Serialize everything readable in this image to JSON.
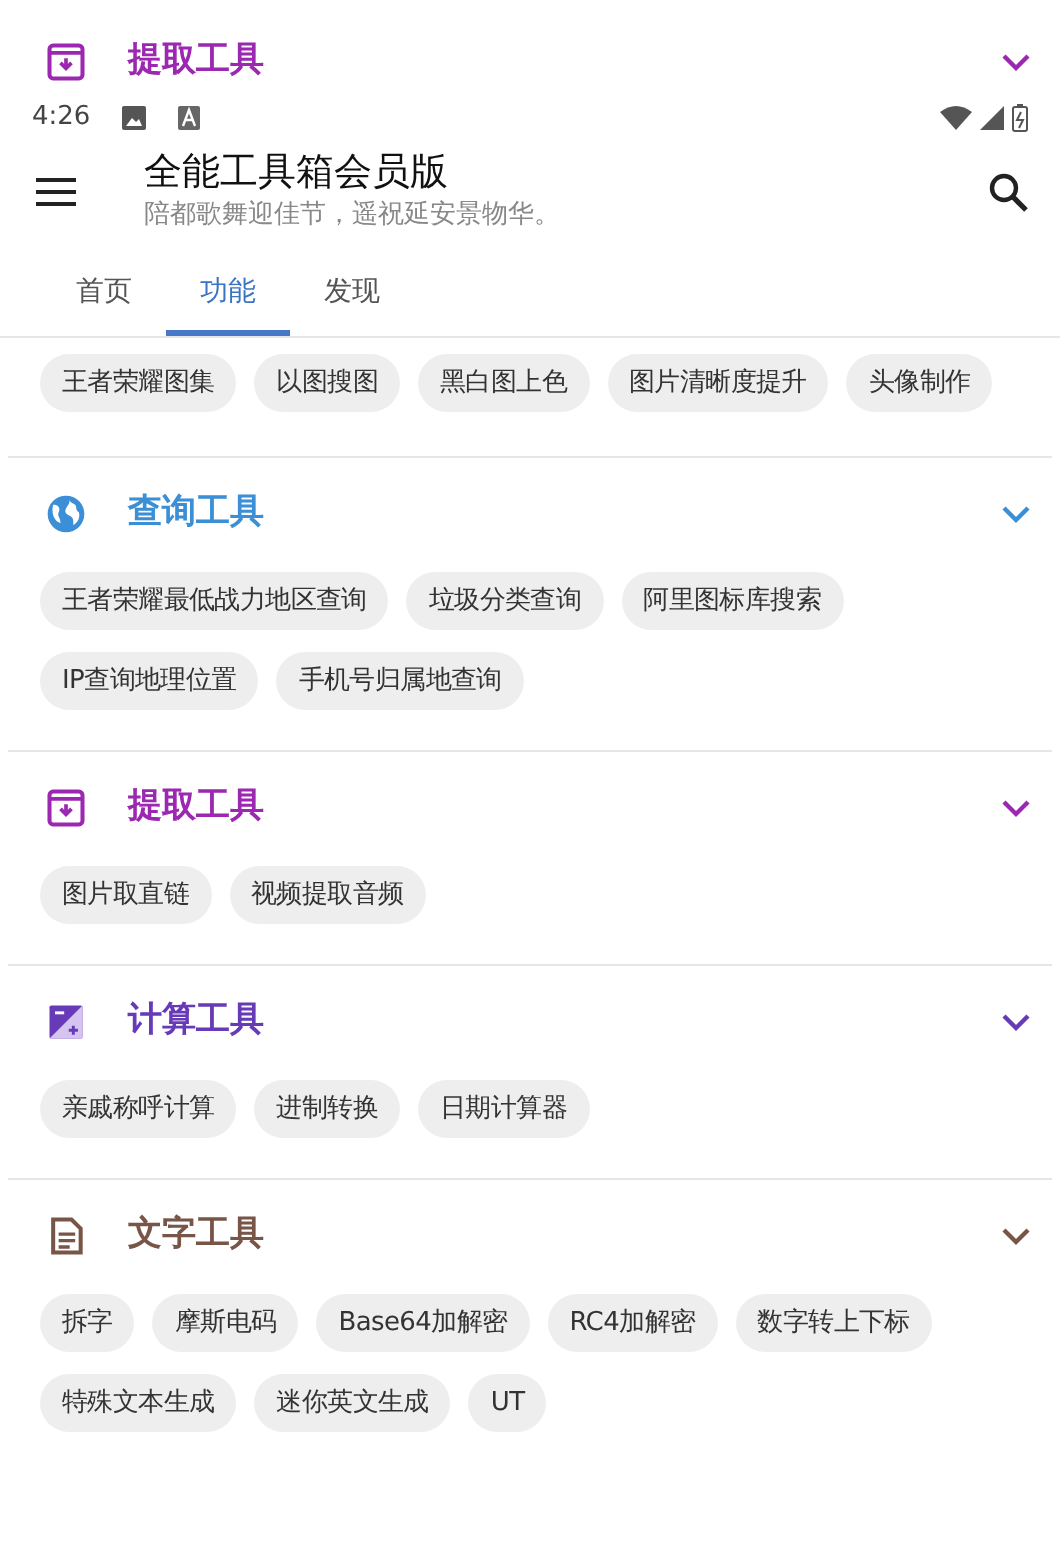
{
  "pinned_section": {
    "title": "提取工具",
    "kind": "archive",
    "color": "#9c27b0"
  },
  "status_bar": {
    "time": "4:26"
  },
  "app_bar": {
    "title": "全能工具箱会员版",
    "subtitle": "陪都歌舞迎佳节，遥祝延安景物华。"
  },
  "tabs": [
    {
      "label": "首页",
      "selected": false
    },
    {
      "label": "功能",
      "selected": true
    },
    {
      "label": "发现",
      "selected": false
    }
  ],
  "partial_section": {
    "tools": [
      "王者荣耀图集",
      "以图搜图",
      "黑白图上色",
      "图片清晰度提升",
      "头像制作"
    ]
  },
  "sections": [
    {
      "title": "查询工具",
      "kind": "globe",
      "color": "#3b8fd6",
      "tools": [
        "王者荣耀最低战力地区查询",
        "垃圾分类查询",
        "阿里图标库搜索",
        "IP查询地理位置",
        "手机号归属地查询"
      ]
    },
    {
      "title": "提取工具",
      "kind": "archive",
      "color": "#9c27b0",
      "tools": [
        "图片取直链",
        "视频提取音频"
      ]
    },
    {
      "title": "计算工具",
      "kind": "calc",
      "color": "#673ab7",
      "tools": [
        "亲戚称呼计算",
        "进制转换",
        "日期计算器"
      ]
    },
    {
      "title": "文字工具",
      "kind": "doc",
      "color": "#795548",
      "tools": [
        "拆字",
        "摩斯电码",
        "Base64加解密",
        "RC4加解密",
        "数字转上下标",
        "特殊文本生成",
        "迷你英文生成",
        "UT"
      ]
    }
  ]
}
